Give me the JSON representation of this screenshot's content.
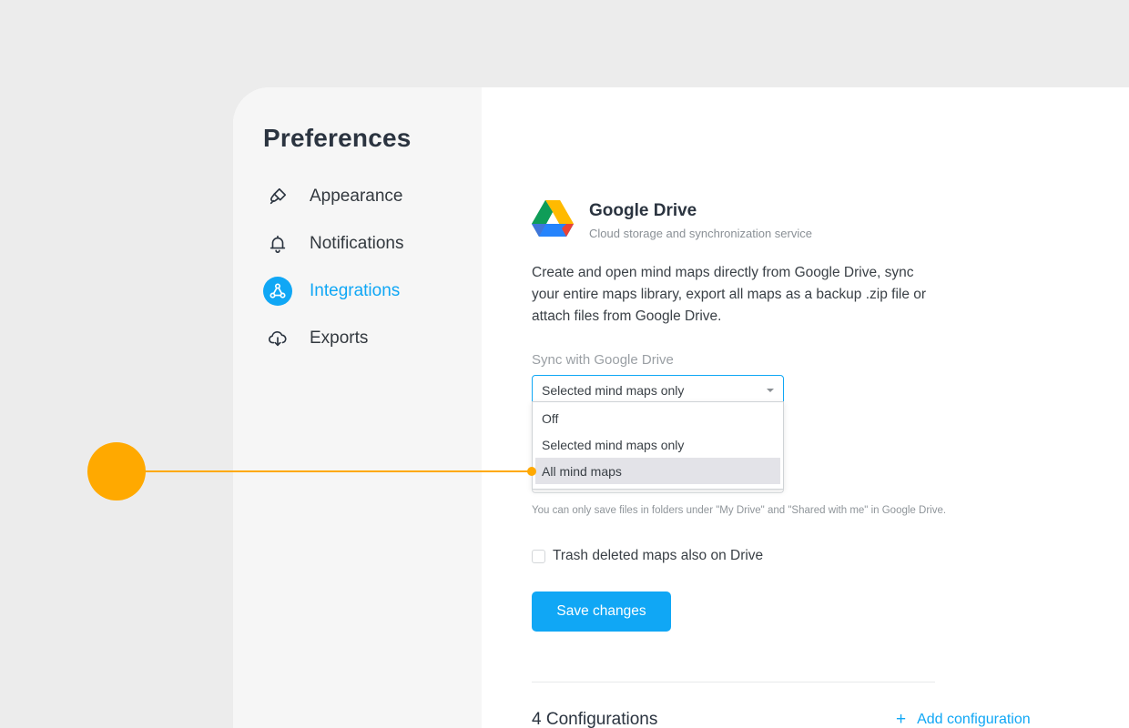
{
  "sidebar": {
    "title": "Preferences",
    "items": [
      {
        "label": "Appearance",
        "icon": "paint-brush-icon",
        "active": false
      },
      {
        "label": "Notifications",
        "icon": "bell-icon",
        "active": false
      },
      {
        "label": "Integrations",
        "icon": "integrations-icon",
        "active": true
      },
      {
        "label": "Exports",
        "icon": "cloud-download-icon",
        "active": false
      }
    ]
  },
  "integration": {
    "title": "Google Drive",
    "subtitle": "Cloud storage and synchronization service",
    "description": "Create and open mind maps directly from Google Drive, sync your entire maps library, export all maps as a backup .zip file or attach files from Google Drive.",
    "sync_label": "Sync with Google Drive",
    "sync_selected": "Selected mind maps only",
    "sync_options": [
      "Off",
      "Selected mind maps only",
      "All mind maps"
    ],
    "highlighted_option": "All mind maps",
    "hint": "You can only save files in folders under \"My Drive\" and \"Shared with me\" in Google Drive.",
    "trash_label": "Trash deleted maps also on Drive",
    "trash_checked": false,
    "save_label": "Save changes",
    "configurations_title": "4 Configurations",
    "add_configuration_label": "Add configuration",
    "add_icon": "+"
  },
  "colors": {
    "accent": "#10a7f5",
    "callout": "#ffa900",
    "sidebar_bg": "#f6f6f6",
    "page_bg": "#ececec"
  }
}
